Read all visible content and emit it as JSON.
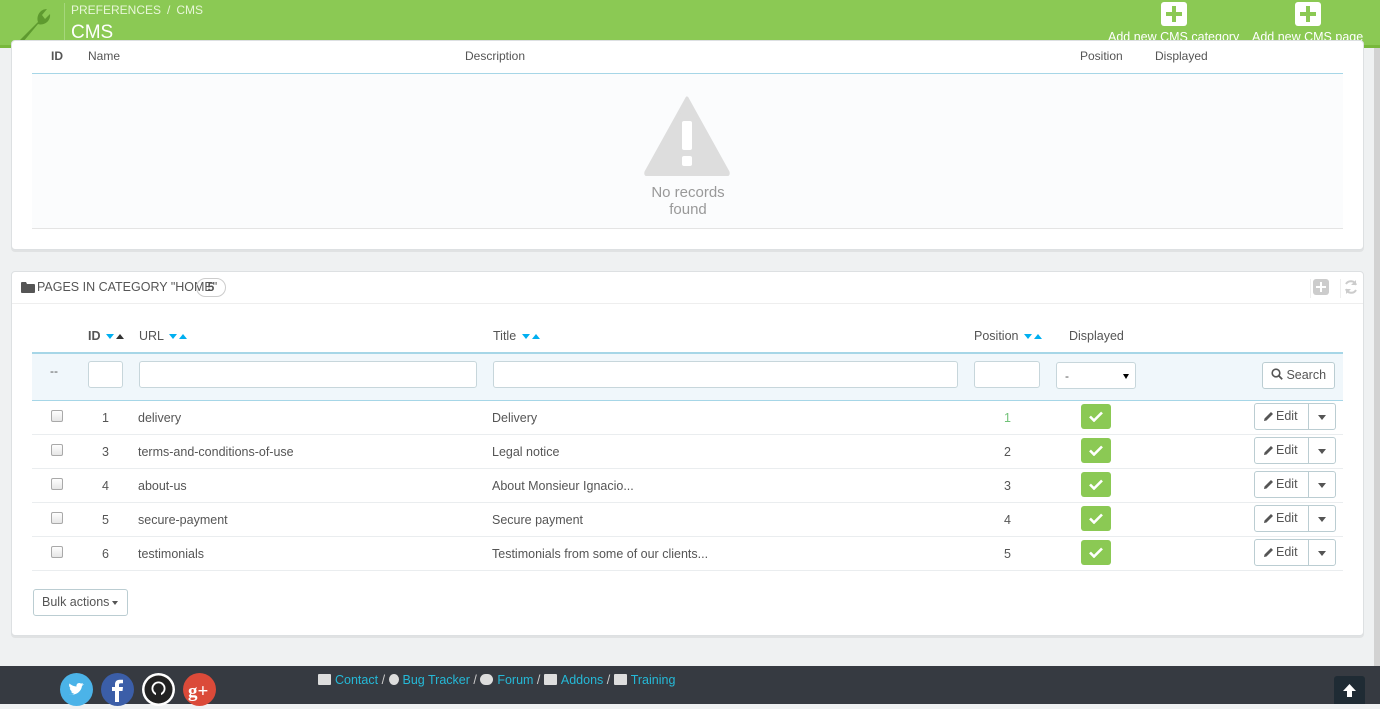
{
  "header": {
    "breadcrumb": [
      "PREFERENCES",
      "CMS"
    ],
    "title": "CMS",
    "toolbar": {
      "add_category": "Add new CMS category",
      "add_page": "Add new CMS page"
    }
  },
  "categories_table": {
    "columns": [
      "ID",
      "Name",
      "Description",
      "Position",
      "Displayed"
    ],
    "empty_message": "No records found"
  },
  "pages_panel": {
    "title": "PAGES IN CATEGORY \"HOME\"",
    "count": "5",
    "columns": {
      "id": "ID",
      "url": "URL",
      "title": "Title",
      "position": "Position",
      "displayed": "Displayed"
    },
    "filter": {
      "dashes": "--",
      "displayed_select": "-",
      "search_label": "Search"
    },
    "rows": [
      {
        "id": "1",
        "url": "delivery",
        "title": "Delivery",
        "position": "1",
        "displayed": true
      },
      {
        "id": "3",
        "url": "terms-and-conditions-of-use",
        "title": "Legal notice",
        "position": "2",
        "displayed": true
      },
      {
        "id": "4",
        "url": "about-us",
        "title": "About Monsieur Ignacio...",
        "position": "3",
        "displayed": true
      },
      {
        "id": "5",
        "url": "secure-payment",
        "title": "Secure payment",
        "position": "4",
        "displayed": true
      },
      {
        "id": "6",
        "url": "testimonials",
        "title": "Testimonials from some of our clients...",
        "position": "5",
        "displayed": true
      }
    ],
    "edit_label": "Edit",
    "bulk_actions": "Bulk actions"
  },
  "footer": {
    "social": [
      "twitter-icon",
      "facebook-icon",
      "github-icon",
      "google-plus-icon"
    ],
    "links": {
      "contact": "Contact",
      "bug_tracker": "Bug Tracker",
      "forum": "Forum",
      "addons": "Addons",
      "training": "Training"
    }
  },
  "colors": {
    "header_green": "#8bc954",
    "link_blue": "#25b9d7",
    "footer_dark": "#363a41"
  }
}
